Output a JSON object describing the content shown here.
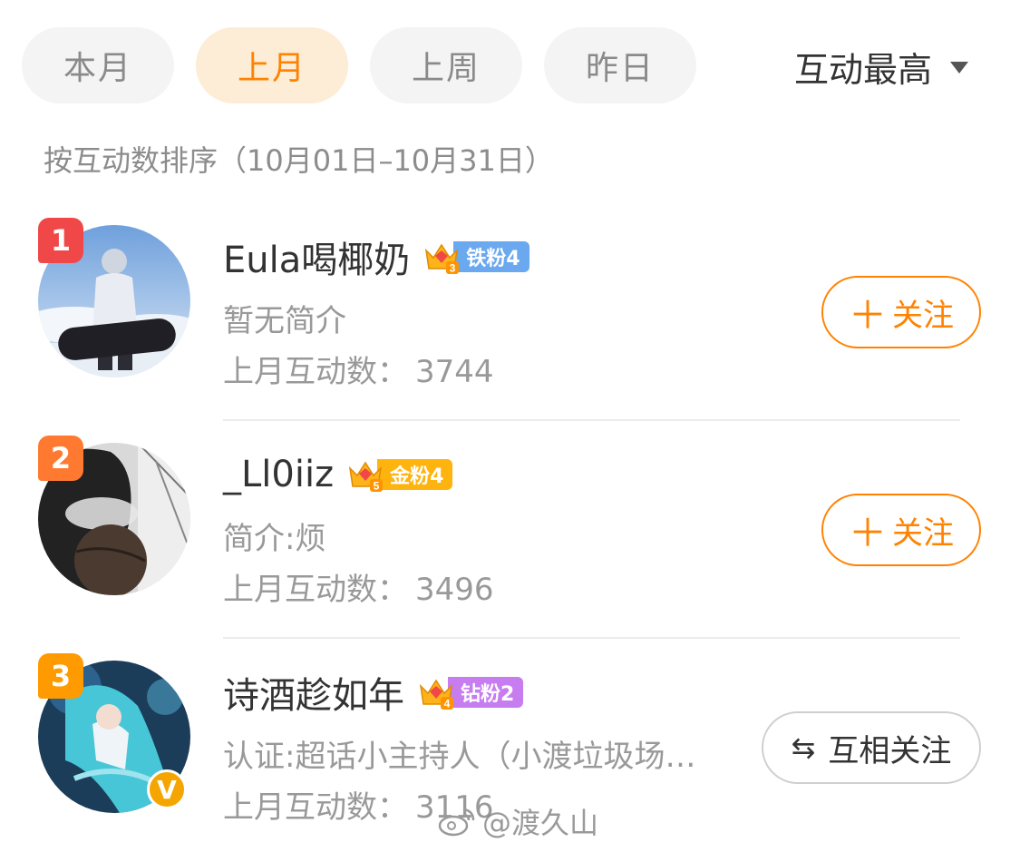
{
  "tabs": [
    {
      "label": "本月",
      "active": false
    },
    {
      "label": "上月",
      "active": true
    },
    {
      "label": "上周",
      "active": false
    },
    {
      "label": "昨日",
      "active": false
    }
  ],
  "sort": {
    "label": "互动最高",
    "icon": "caret-down-icon"
  },
  "subtitle": "按互动数排序（10月01日–10月31日）",
  "colors": {
    "accent": "#ff8200",
    "rank1": "#f04848",
    "rank2": "#ff7a30",
    "rank3": "#ff9a00"
  },
  "users": [
    {
      "rank": "1",
      "name": "Eula喝椰奶",
      "badge_level": "3",
      "badge_label": "铁粉4",
      "badge_color": "#6aa8f0",
      "bio": "暂无简介",
      "count_label": "上月互动数：",
      "count": "3744",
      "button": "关注",
      "button_icon": "plus-icon"
    },
    {
      "rank": "2",
      "name": "_Ll0iiz",
      "badge_level": "5",
      "badge_label": "金粉4",
      "badge_color": "#ffb30f",
      "bio": "简介:烦",
      "count_label": "上月互动数：",
      "count": "3496",
      "button": "关注",
      "button_icon": "plus-icon"
    },
    {
      "rank": "3",
      "name": "诗酒趁如年",
      "badge_level": "4",
      "badge_label": "钻粉2",
      "badge_color": "#c77cf0",
      "bio": "认证:超话小主持人（小渡垃圾场…",
      "count_label": "上月互动数：",
      "count": "3116",
      "button": "互相关注",
      "button_icon": "swap-arrows-icon",
      "verified": "V"
    }
  ],
  "watermark": "@渡久山"
}
